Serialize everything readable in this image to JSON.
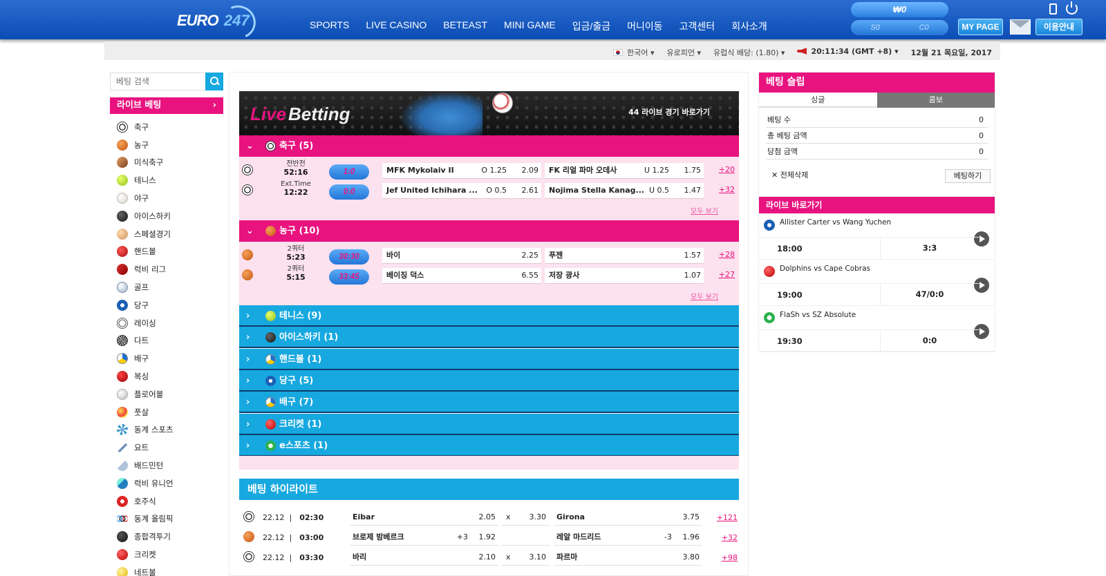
{
  "header": {
    "logo_text": "EURO",
    "logo_num": "247",
    "nav": [
      "SPORTS",
      "LIVE CASINO",
      "BETEAST",
      "MINI GAME",
      "입금/출금",
      "머니이동",
      "고객센터",
      "회사소개"
    ],
    "balance": "₩0",
    "sub_left": "S0",
    "sub_right": "C0",
    "mypage": "MY PAGE",
    "guide": "이용안내"
  },
  "infobar": {
    "language": "한국어",
    "region": "유로피언",
    "odds": "유럽식 배당: (1.80)",
    "time": "20:11:34 (GMT +8)",
    "date": "12월 21 목요일, 2017"
  },
  "sidebar": {
    "search_placeholder": "베팅 검색",
    "live_label": "라이브 베팅",
    "live_arrow": "›",
    "sports": [
      {
        "label": "축구",
        "icon": "soc"
      },
      {
        "label": "농구",
        "icon": "bsk"
      },
      {
        "label": "미식축구",
        "icon": "amf"
      },
      {
        "label": "테니스",
        "icon": "ten"
      },
      {
        "label": "야구",
        "icon": "bas"
      },
      {
        "label": "아이스하키",
        "icon": "hok"
      },
      {
        "label": "스페셜경기",
        "icon": "spc"
      },
      {
        "label": "핸드볼",
        "icon": "hnd"
      },
      {
        "label": "럭비 리그",
        "icon": "rug"
      },
      {
        "label": "골프",
        "icon": "glf"
      },
      {
        "label": "당구",
        "icon": "bil"
      },
      {
        "label": "레이싱",
        "icon": "rac"
      },
      {
        "label": "다트",
        "icon": "drt"
      },
      {
        "label": "배구",
        "icon": "vol"
      },
      {
        "label": "복싱",
        "icon": "box"
      },
      {
        "label": "플로어볼",
        "icon": "flb"
      },
      {
        "label": "풋살",
        "icon": "fut"
      },
      {
        "label": "동계 스포츠",
        "icon": "win"
      },
      {
        "label": "요트",
        "icon": "yac"
      },
      {
        "label": "배드민턴",
        "icon": "bad"
      },
      {
        "label": "럭비 유니언",
        "icon": "run"
      },
      {
        "label": "호주식",
        "icon": "aus"
      },
      {
        "label": "동계 올림픽",
        "icon": "oly"
      },
      {
        "label": "종합격투기",
        "icon": "mma"
      },
      {
        "label": "크리켓",
        "icon": "crk"
      },
      {
        "label": "네트볼",
        "icon": "net"
      }
    ]
  },
  "banner": {
    "live": "Live",
    "betting": "Betting",
    "caption": "44 라이브 경기 바로가기"
  },
  "live": {
    "soccer": {
      "header": "축구 (5)",
      "see_all": "모두 보기",
      "rows": [
        {
          "period": "전반전",
          "clock": "52:16",
          "score": "1:0",
          "home": "MFK Mykolaiv II",
          "h_line": "O 1.25",
          "h_odds": "2.09",
          "away": "FK 리얼 파마 오데사",
          "a_line": "U 1.25",
          "a_odds": "1.75",
          "more": "+20"
        },
        {
          "period": "Ext.Time",
          "clock": "12:22",
          "score": "0:0",
          "home": "Jef United Ichihara ...",
          "h_line": "O 0.5",
          "h_odds": "2.61",
          "away": "Nojima Stella Kanag...",
          "a_line": "U 0.5",
          "a_odds": "1.47",
          "more": "+32"
        }
      ]
    },
    "basketball": {
      "header": "농구 (10)",
      "see_all": "모두 보기",
      "rows": [
        {
          "period": "2쿼터",
          "clock": "5:23",
          "score": "30:30",
          "home": "바이",
          "h_line": "",
          "h_odds": "2.25",
          "away": "푸젠",
          "a_line": "",
          "a_odds": "1.57",
          "more": "+28"
        },
        {
          "period": "2쿼터",
          "clock": "5:15",
          "score": "33:45",
          "home": "베이징 덕스",
          "h_line": "",
          "h_odds": "6.55",
          "away": "저장 광사",
          "a_line": "",
          "a_odds": "1.07",
          "more": "+27"
        }
      ]
    },
    "collapsed": [
      {
        "label": "테니스 (9)",
        "icon": "ten"
      },
      {
        "label": "아이스하키 (1)",
        "icon": "hok"
      },
      {
        "label": "핸드볼 (1)",
        "icon": "vol"
      },
      {
        "label": "당구 (5)",
        "icon": "bil"
      },
      {
        "label": "배구 (7)",
        "icon": "vol"
      },
      {
        "label": "크리켓 (1)",
        "icon": "crk"
      },
      {
        "label": "e스포츠 (1)",
        "icon": "esp"
      }
    ]
  },
  "highlights": {
    "title": "베팅 하이라이트",
    "rows": [
      {
        "icon": "soc",
        "date": "22.12",
        "time": "02:30",
        "home": "Eibar",
        "h_line": "",
        "h_odds": "2.05",
        "draw_label": "x",
        "draw": "3.30",
        "away": "Girona",
        "a_line": "",
        "a_odds": "3.75",
        "more": "+121"
      },
      {
        "icon": "bsk",
        "date": "22.12",
        "time": "03:00",
        "home": "브로제 밤베르크",
        "h_line": "+3",
        "h_odds": "1.92",
        "draw_label": "",
        "draw": "",
        "away": "레알 마드리드",
        "a_line": "-3",
        "a_odds": "1.96",
        "more": "+32"
      },
      {
        "icon": "soc",
        "date": "22.12",
        "time": "03:30",
        "home": "바리",
        "h_line": "",
        "h_odds": "2.10",
        "draw_label": "x",
        "draw": "3.10",
        "away": "파르마",
        "a_line": "",
        "a_odds": "3.80",
        "more": "+98"
      }
    ]
  },
  "slip": {
    "title": "베팅 슬립",
    "tab_single": "싱글",
    "tab_combo": "콤보",
    "lines": [
      {
        "label": "베팅 수",
        "value": "0"
      },
      {
        "label": "총 베팅 금액",
        "value": "0"
      },
      {
        "label": "당첨 금액",
        "value": "0"
      }
    ],
    "delete_all": "✕ 전체삭제",
    "bet_button": "베팅하기"
  },
  "live_quick": {
    "title": "라이브 바로가기",
    "matches": [
      {
        "icon": "bil",
        "name": "Allister Carter vs Wang Yuchen",
        "time": "18:00",
        "score": "3:3"
      },
      {
        "icon": "crk",
        "name": "Dolphins vs Cape Cobras",
        "time": "19:00",
        "score": "47/0:0"
      },
      {
        "icon": "esp",
        "name": "FlaSh vs SZ Absolute",
        "time": "19:30",
        "score": "0:0"
      }
    ]
  }
}
